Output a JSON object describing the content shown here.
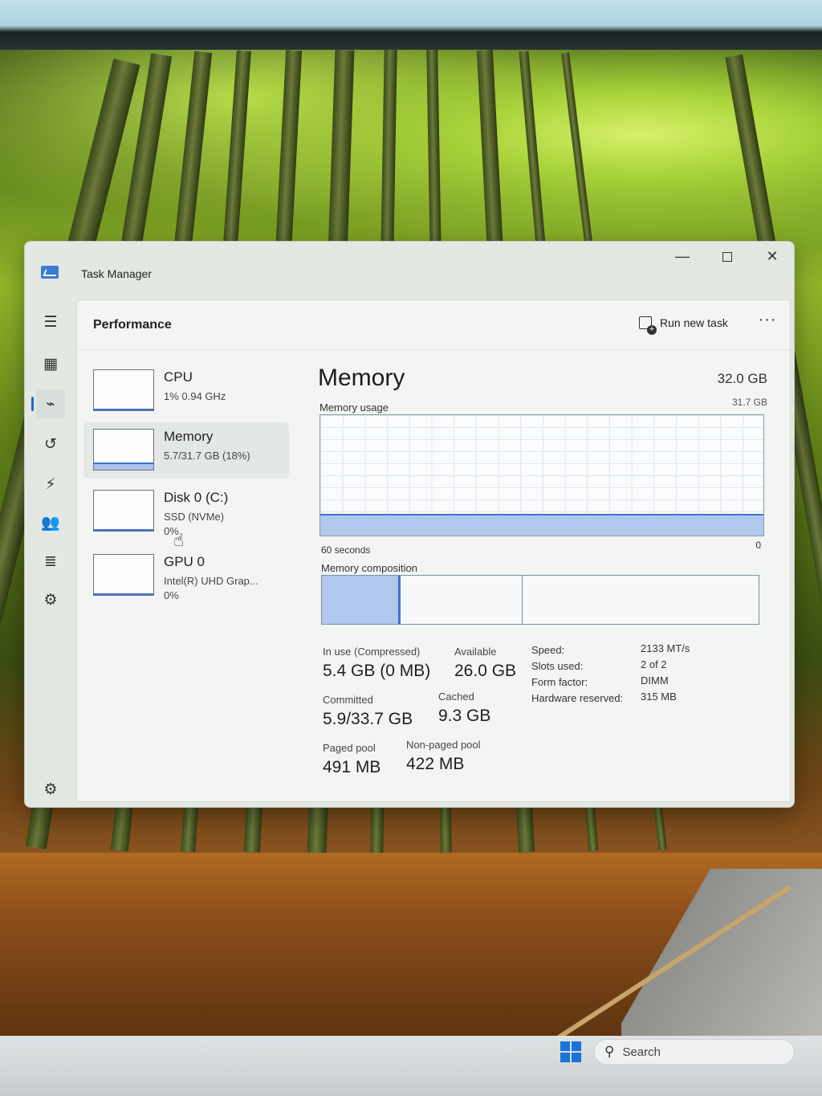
{
  "window": {
    "title": "Task Manager",
    "controls": {
      "minimize": "—",
      "close": "✕"
    }
  },
  "header": {
    "page_title": "Performance",
    "run_new_task": "Run new task",
    "more": "···"
  },
  "nav_icons": [
    "menu-icon",
    "processes-icon",
    "performance-icon",
    "app-history-icon",
    "startup-apps-icon",
    "users-icon",
    "details-icon",
    "services-icon",
    "settings-icon"
  ],
  "devices": [
    {
      "name": "CPU",
      "line1": "1% 0.94 GHz",
      "line2": "",
      "usage_fraction": 0.01
    },
    {
      "name": "Memory",
      "line1": "5.7/31.7 GB (18%)",
      "line2": "",
      "usage_fraction": 0.18
    },
    {
      "name": "Disk 0 (C:)",
      "line1": "SSD (NVMe)",
      "line2": "0%",
      "usage_fraction": 0.0
    },
    {
      "name": "GPU 0",
      "line1": "Intel(R) UHD Grap...",
      "line2": "0%",
      "usage_fraction": 0.0
    }
  ],
  "detail": {
    "title": "Memory",
    "total": "32.0 GB",
    "usage_label": "Memory usage",
    "max_label": "31.7 GB",
    "graph_left": "60 seconds",
    "graph_right": "0",
    "usage_fraction": 0.18,
    "composition_label": "Memory composition",
    "composition": [
      {
        "name": "in-use",
        "fraction": 0.18
      },
      {
        "name": "modified",
        "fraction": 0.28
      },
      {
        "name": "standby",
        "fraction": 0.54
      }
    ],
    "stats": {
      "in_use_label": "In use (Compressed)",
      "in_use": "5.4 GB (0 MB)",
      "available_label": "Available",
      "available": "26.0 GB",
      "committed_label": "Committed",
      "committed": "5.9/33.7 GB",
      "cached_label": "Cached",
      "cached": "9.3 GB",
      "paged_pool_label": "Paged pool",
      "paged_pool": "491 MB",
      "non_paged_pool_label": "Non-paged pool",
      "non_paged_pool": "422 MB"
    },
    "hardware": {
      "speed_label": "Speed:",
      "speed": "2133 MT/s",
      "slots_label": "Slots used:",
      "slots": "2 of 2",
      "form_label": "Form factor:",
      "form": "DIMM",
      "reserved_label": "Hardware reserved:",
      "reserved": "315 MB"
    }
  },
  "taskbar": {
    "search_placeholder": "Search"
  },
  "colors": {
    "accent": "#3e72d0",
    "memory_fill": "#b0c8ee"
  }
}
